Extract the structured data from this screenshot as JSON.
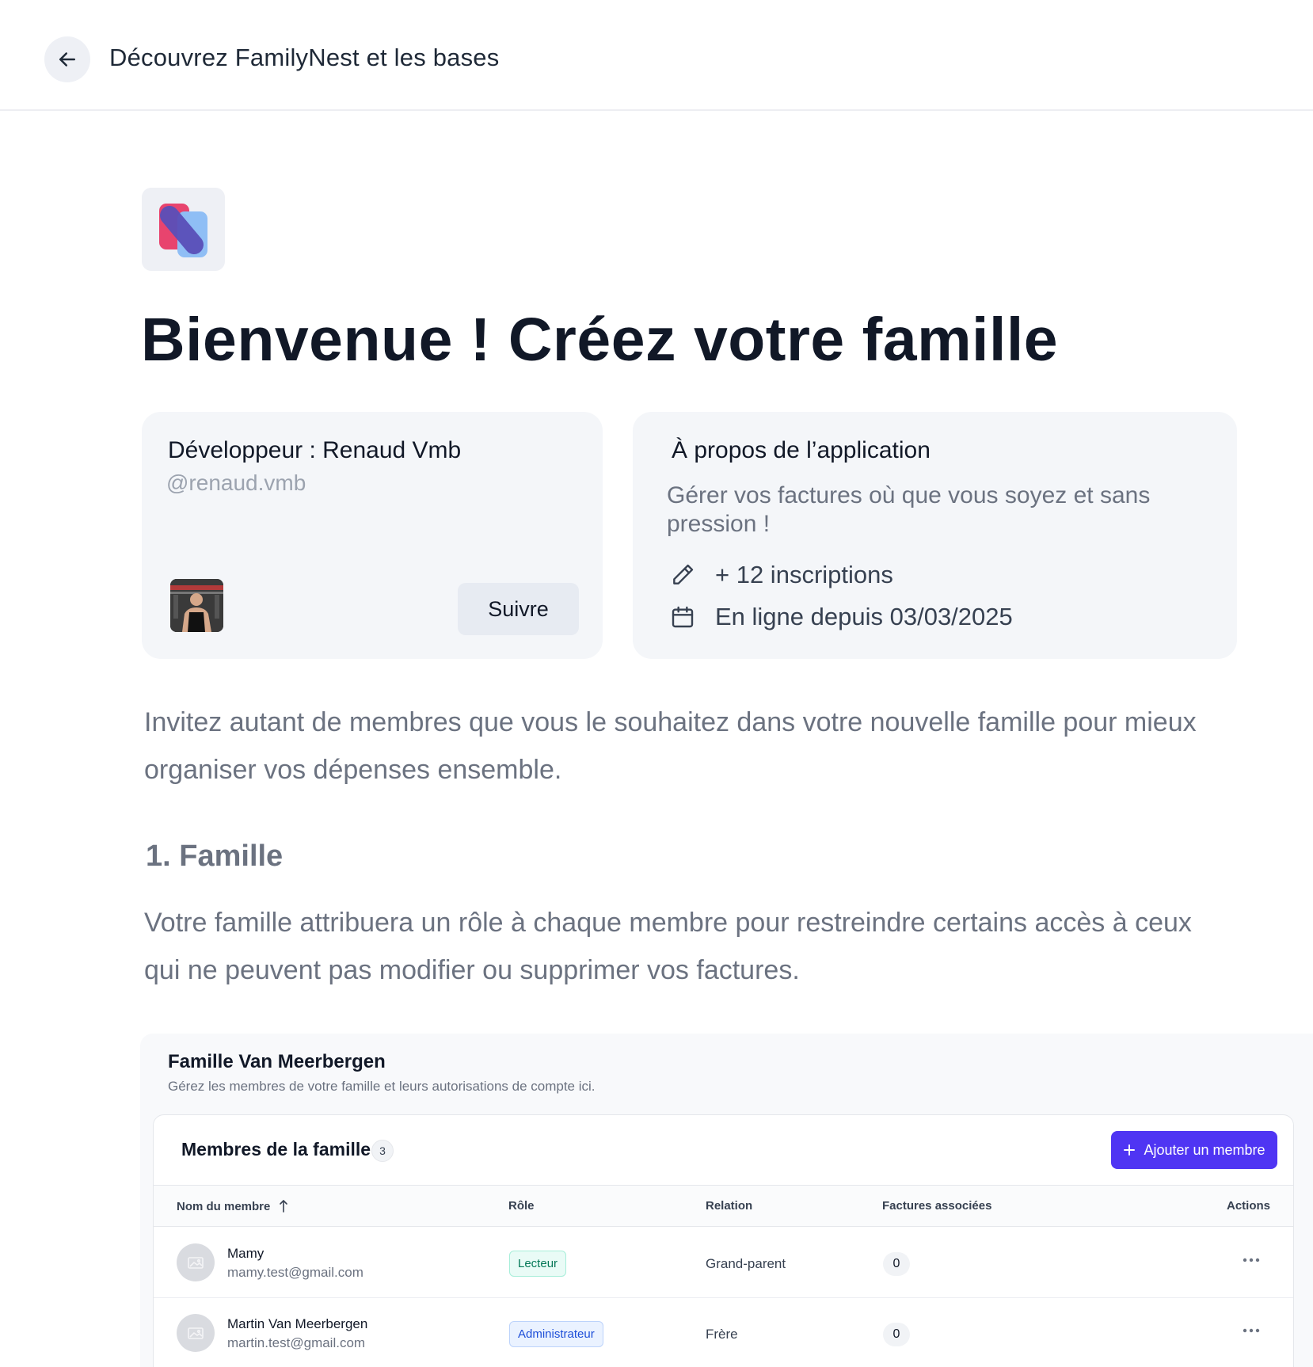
{
  "header": {
    "title": "Découvrez FamilyNest et les bases"
  },
  "hero": {
    "title": "Bienvenue ! Créez votre famille"
  },
  "developer": {
    "label": "Développeur : Renaud Vmb",
    "handle": "@renaud.vmb",
    "follow_label": "Suivre"
  },
  "about": {
    "title": "À propos de l’application",
    "description": "Gérer vos factures où que vous soyez et sans pression !",
    "signups": "+ 12 inscriptions",
    "online_since": "En ligne depuis 03/03/2025"
  },
  "intro": {
    "text": "Invitez autant de membres que vous le souhaitez dans votre nouvelle famille pour mieux organiser vos dépenses ensemble."
  },
  "section1": {
    "heading": "1. Famille",
    "text": "Votre famille attribuera un rôle à chaque membre pour restreindre certains accès à ceux qui ne peuvent pas modifier ou supprimer vos factures."
  },
  "family": {
    "title": "Famille Van Meerbergen",
    "subtitle": "Gérez les membres de votre famille et leurs autorisations de compte ici.",
    "members_title": "Membres de la famille",
    "members_count": "3",
    "add_button": "Ajouter un membre",
    "columns": {
      "name": "Nom du membre",
      "role": "Rôle",
      "relation": "Relation",
      "bills": "Factures associées",
      "actions": "Actions"
    },
    "rows": [
      {
        "name": "Mamy",
        "email": "mamy.test@gmail.com",
        "role": "Lecteur",
        "relation": "Grand-parent",
        "bills": "0"
      },
      {
        "name": "Martin Van Meerbergen",
        "email": "martin.test@gmail.com",
        "role": "Administrateur",
        "relation": "Frère",
        "bills": "0"
      }
    ]
  },
  "colors": {
    "accent": "#4f35f3",
    "card_bg": "#f4f6f9",
    "muted_text": "#6b7280"
  },
  "icons": {
    "back": "arrow-left-icon",
    "pencil": "pencil-icon",
    "calendar": "calendar-icon",
    "plus": "plus-icon",
    "sort": "arrow-up-icon",
    "more": "more-horizontal-icon"
  }
}
